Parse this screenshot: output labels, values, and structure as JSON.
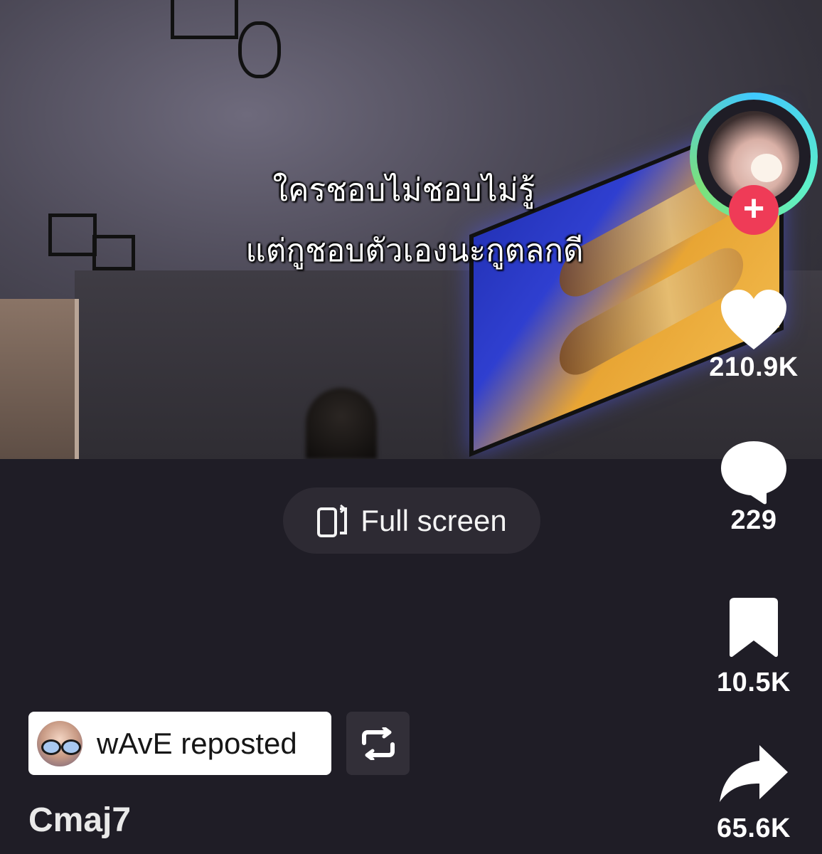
{
  "video": {
    "caption_line1": "ใครชอบไม่ชอบไม่รู้",
    "caption_line2": "แต่กูชอบตัวเองนะกูตลกดี"
  },
  "actions": {
    "likes": "210.9K",
    "comments": "229",
    "bookmarks": "10.5K",
    "shares": "65.6K"
  },
  "fullscreen": {
    "label": "Full screen"
  },
  "repost": {
    "label": "wAvE reposted"
  },
  "sound": {
    "title": "Cmaj7"
  },
  "colors": {
    "background": "#1f1d26",
    "follow_button": "#ef3b57",
    "avatar_ring": "#40c8ff"
  },
  "icons": [
    "follow-plus-icon",
    "heart-icon",
    "comment-icon",
    "bookmark-icon",
    "share-icon",
    "fullscreen-icon",
    "repost-icon"
  ]
}
